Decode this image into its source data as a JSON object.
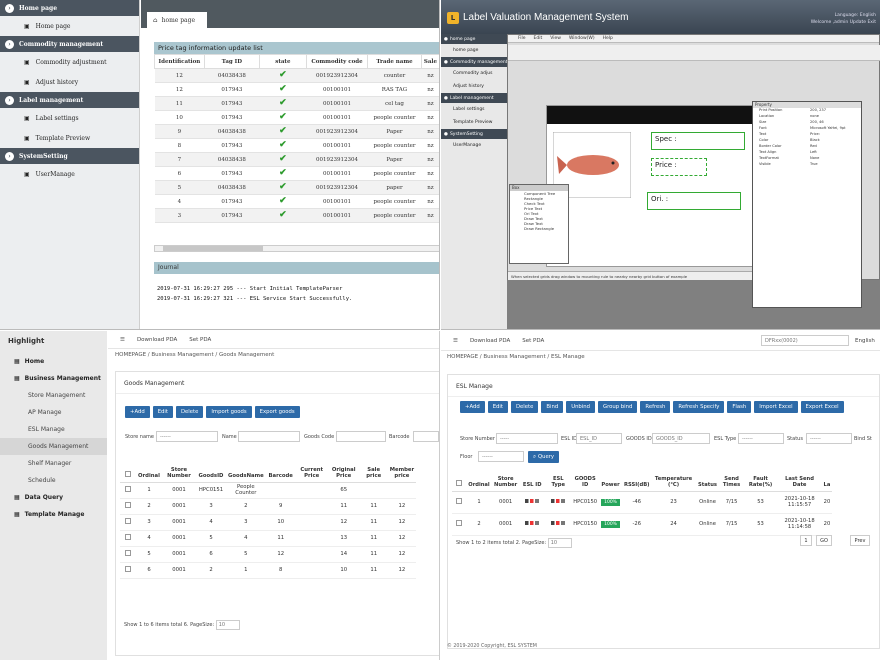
{
  "q1": {
    "sidebar": [
      {
        "group": "Home page",
        "items": [
          "Home page"
        ]
      },
      {
        "group": "Commodity management",
        "items": [
          "Commodity adjustment",
          "Adjust history"
        ]
      },
      {
        "group": "Label management",
        "items": [
          "Label settings",
          "Template Preview"
        ]
      },
      {
        "group": "SystemSetting",
        "items": [
          "UserManage"
        ]
      }
    ],
    "tab": "home page",
    "panel_title": "Price tag information update list",
    "columns": [
      "Identification",
      "Tag ID",
      "state",
      "Commodity code",
      "Trade name",
      "Sale"
    ],
    "rows": [
      [
        "12",
        "04038438",
        "",
        "001923912304",
        "counter",
        "nz"
      ],
      [
        "12",
        "017943",
        "",
        "00100101",
        "RAS TAG",
        "nz"
      ],
      [
        "11",
        "017943",
        "",
        "00100101",
        "cel tag",
        "nz"
      ],
      [
        "10",
        "017943",
        "",
        "00100101",
        "people counter",
        "nz"
      ],
      [
        "9",
        "04038438",
        "",
        "001923912304",
        "Paper",
        "nz"
      ],
      [
        "8",
        "017943",
        "",
        "00100101",
        "people counter",
        "nz"
      ],
      [
        "7",
        "04038438",
        "",
        "001923912304",
        "Paper",
        "nz"
      ],
      [
        "6",
        "017943",
        "",
        "00100101",
        "people counter",
        "nz"
      ],
      [
        "5",
        "04038438",
        "",
        "001923912304",
        "paper",
        "nz"
      ],
      [
        "4",
        "017943",
        "",
        "00100101",
        "people counter",
        "nz"
      ],
      [
        "3",
        "017943",
        "",
        "00100101",
        "people counter",
        "nz"
      ]
    ],
    "journal_title": "Journal",
    "journal": [
      "2019-07-31 16:29:27 295 --- Start Initial TemplateParser",
      "2019-07-31 16:29:27 321 --- ESL Service Start Successfully."
    ]
  },
  "q2": {
    "title": "Label Valuation Management System",
    "top_right": [
      "Language: English",
      "Welcome ,admin",
      "Update",
      "Exit"
    ],
    "sidebar": [
      {
        "group": "home page",
        "items": [
          "home page"
        ]
      },
      {
        "group": "Commodity management",
        "items": [
          "Commodity adjus",
          "Adjust history"
        ]
      },
      {
        "group": "Label management",
        "items": [
          "Label settings",
          "Template Preview"
        ]
      },
      {
        "group": "SystemSetting",
        "items": [
          "UserManage"
        ]
      }
    ],
    "menu": [
      "File",
      "Edit",
      "View",
      "Window(W)",
      "Help"
    ],
    "boxes": {
      "spec": "Spec :",
      "price": "Price :",
      "ori": "Ori. :"
    },
    "prop_title": "Property",
    "props": [
      [
        "Print Position",
        "200, 237"
      ],
      [
        "Location",
        "none"
      ],
      [
        "Size",
        "200, 46"
      ],
      [
        "Font",
        "Microsoft YaHei, 9pt"
      ],
      [
        "Text",
        "Price:"
      ],
      [
        "Color",
        "Black"
      ],
      [
        "Border Color",
        "Red"
      ],
      [
        "Text Align",
        "Left"
      ],
      [
        "TextFormat",
        "None"
      ],
      [
        "Visible",
        "True"
      ]
    ],
    "comp_title": "Box",
    "comp_items": [
      "Component Tree",
      "Rectangle",
      "Check Text",
      "Price Text",
      "Ori Text",
      "Draw Text",
      "Draw Text",
      "Draw Rectangle"
    ],
    "status": "When selected grids drag window to mounting rule to nearby nearby grid button of example"
  },
  "q3": {
    "brand": "Highlight",
    "header": [
      "Download PDA",
      "Set PDA"
    ],
    "nav": [
      {
        "label": "Home",
        "kind": "grp"
      },
      {
        "label": "Business Management",
        "kind": "grp"
      },
      {
        "label": "Store Management",
        "kind": "sub"
      },
      {
        "label": "AP Manage",
        "kind": "sub"
      },
      {
        "label": "ESL Manage",
        "kind": "sub"
      },
      {
        "label": "Goods Management",
        "kind": "sub",
        "active": true
      },
      {
        "label": "Shelf Manager",
        "kind": "sub"
      },
      {
        "label": "Schedule",
        "kind": "sub"
      },
      {
        "label": "Data Query",
        "kind": "grp"
      },
      {
        "label": "Template Manage",
        "kind": "grp"
      }
    ],
    "breadcrumb": "HOMEPAGE / Business Management / Goods Management",
    "card_title": "Goods Management",
    "buttons": [
      "+Add",
      "Edit",
      "Delete",
      "Import goods",
      "Export goods"
    ],
    "filters": {
      "store": "Store name",
      "store_val": "------",
      "name": "Name",
      "code": "Goods Code",
      "barcode": "Barcode"
    },
    "columns": [
      "Ordinal",
      "Store Number",
      "GoodsID",
      "GoodsName",
      "Barcode",
      "Current Price",
      "Original Price",
      "Sale price",
      "Member price"
    ],
    "rows": [
      [
        "1",
        "0001",
        "HPC0151",
        "People Counter",
        "",
        "",
        "65",
        "",
        ""
      ],
      [
        "2",
        "0001",
        "3",
        "2",
        "9",
        "",
        "11",
        "11",
        "12"
      ],
      [
        "3",
        "0001",
        "4",
        "3",
        "10",
        "",
        "12",
        "11",
        "12"
      ],
      [
        "4",
        "0001",
        "5",
        "4",
        "11",
        "",
        "13",
        "11",
        "12"
      ],
      [
        "5",
        "0001",
        "6",
        "5",
        "12",
        "",
        "14",
        "11",
        "12"
      ],
      [
        "6",
        "0001",
        "2",
        "1",
        "8",
        "",
        "10",
        "11",
        "12"
      ]
    ],
    "footer": "Show 1 to 6 items total 6.  PageSize:",
    "page_size": "10"
  },
  "q4": {
    "header": [
      "Download PDA",
      "Set PDA"
    ],
    "store_select": "DFRxx(0002)",
    "lang": "English",
    "breadcrumb": "HOMEPAGE / Business Management / ESL Manage",
    "card_title": "ESL Manage",
    "buttons": [
      "+Add",
      "Edit",
      "Delete",
      "Bind",
      "Unbind",
      "Group bind",
      "Refresh",
      "Refresh Specify",
      "Flash",
      "Import Excel",
      "Export Excel"
    ],
    "filters": {
      "store": "Store Number",
      "store_val": "-----",
      "esl": "ESL ID",
      "esl_ph": "ESL_ID",
      "goods": "GOODS ID",
      "goods_ph": "GOODS_ID",
      "type": "ESL Type",
      "type_val": "------",
      "status": "Status",
      "status_val": "------",
      "bind": "Bind St",
      "floor": "Floor",
      "floor_val": "------",
      "query": "Query"
    },
    "columns": [
      "Ordinal",
      "Store Number",
      "ESL ID",
      "ESL Type",
      "GOODS ID",
      "Power",
      "RSSI(dB)",
      "Temperature (°C)",
      "Status",
      "Send Times",
      "Fault Rate(%)",
      "Last Send Date",
      "La"
    ],
    "rows": [
      [
        "1",
        "0001",
        "",
        "",
        "HPC0150",
        "100%",
        "-46",
        "23",
        "Online",
        "7/15",
        "53",
        "2021-10-18 11:15:57",
        "20"
      ],
      [
        "2",
        "0001",
        "",
        "",
        "HPC0150",
        "100%",
        "-26",
        "24",
        "Online",
        "7/15",
        "53",
        "2021-10-18 11:14:58",
        "20"
      ]
    ],
    "footer": "Show 1 to 2 items total 2.  PageSize:",
    "page_size": "10",
    "pager": [
      "1",
      "GO",
      "Prev"
    ],
    "copyright": "© 2019-2020 Copyright, ESL SYSTEM"
  }
}
